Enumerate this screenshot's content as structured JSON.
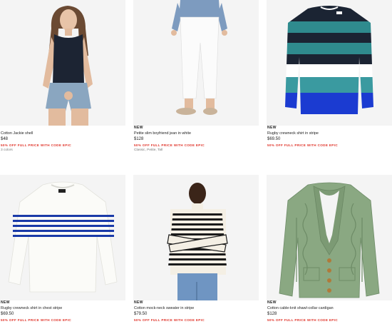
{
  "products": [
    {
      "badge": "",
      "name": "Cotton Jackie shell",
      "price": "$48",
      "promo": "50% OFF FULL PRICE WITH CODE EPIC",
      "meta": "3 colors"
    },
    {
      "badge": "NEW",
      "name": "Petite slim boyfriend jean in white",
      "price": "$128",
      "promo": "50% OFF FULL PRICE WITH CODE EPIC",
      "meta": "Classic, Petite, Tall"
    },
    {
      "badge": "NEW",
      "name": "Rugby crewneck shirt in stripe",
      "price": "$69.50",
      "promo": "50% OFF FULL PRICE WITH CODE EPIC",
      "meta": ""
    },
    {
      "badge": "NEW",
      "name": "Rugby crewneck shirt in chest stripe",
      "price": "$69.50",
      "promo": "50% OFF FULL PRICE WITH CODE EPIC",
      "meta": ""
    },
    {
      "badge": "NEW",
      "name": "Cotton mock-neck sweater in stripe",
      "price": "$79.50",
      "promo": "50% OFF FULL PRICE WITH CODE EPIC",
      "meta": ""
    },
    {
      "badge": "NEW",
      "name": "Cotton cable-knit shawl-collar cardigan",
      "price": "$128",
      "promo": "50% OFF FULL PRICE WITH CODE EPIC",
      "meta": ""
    }
  ],
  "colors": {
    "promo_red": "#e0352b",
    "image_bg": "#f3f3f3"
  }
}
